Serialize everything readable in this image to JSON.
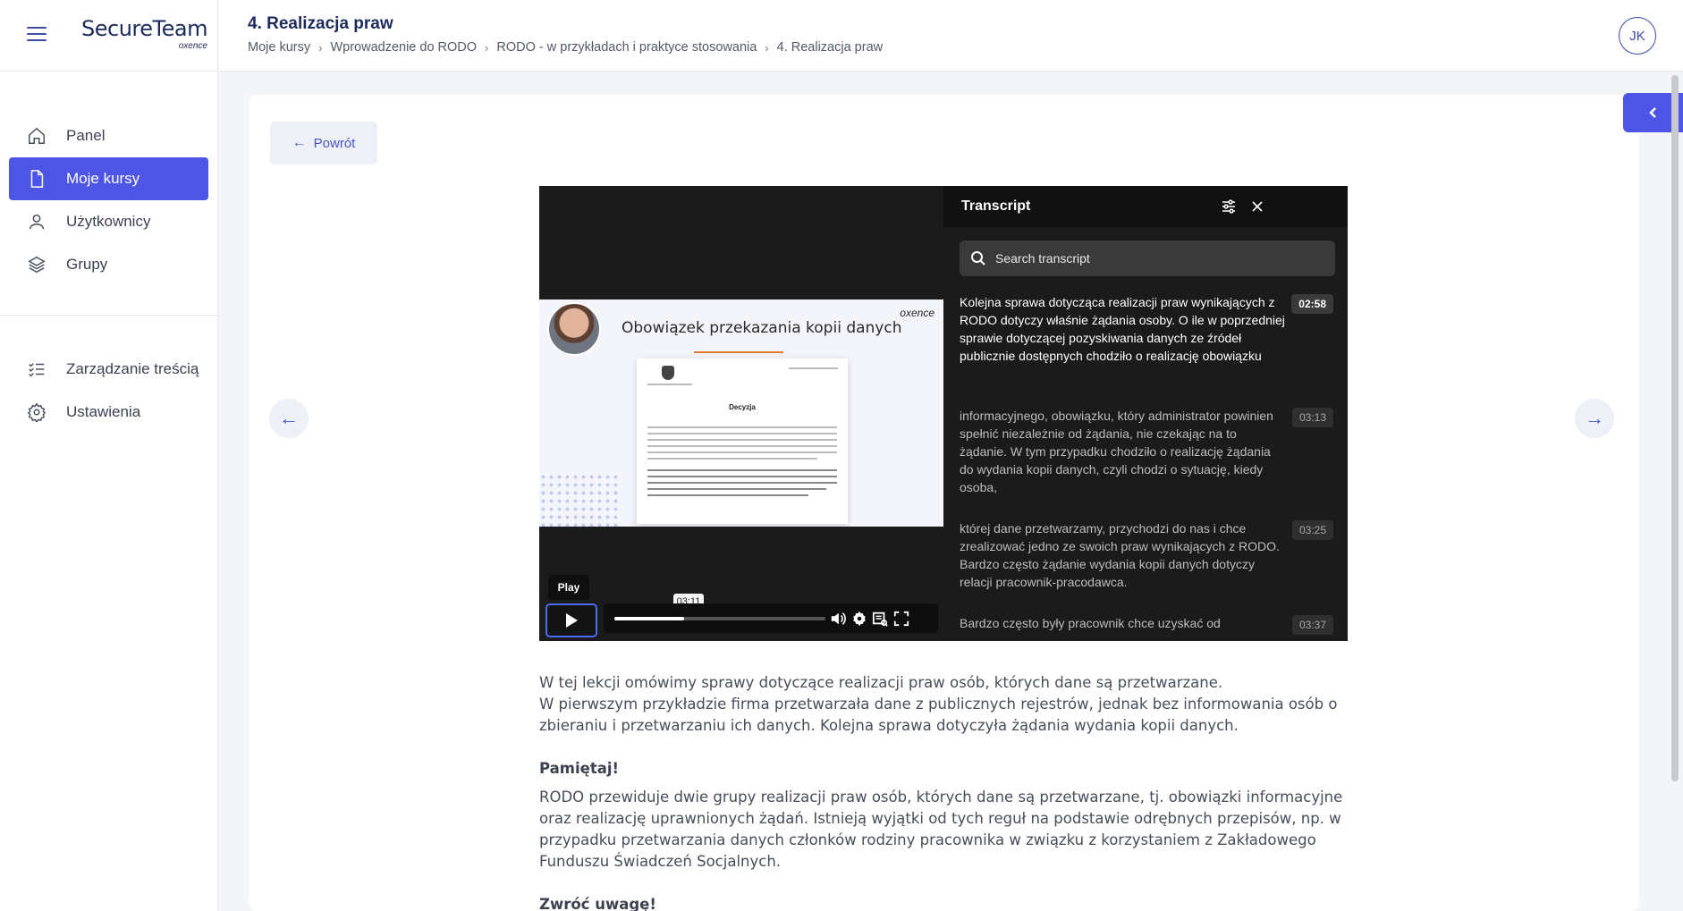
{
  "sidebar": {
    "logo_main": "SecureTeam",
    "logo_sub": "oxence",
    "items": [
      {
        "label": "Panel",
        "icon": "home-icon"
      },
      {
        "label": "Moje kursy",
        "icon": "document-icon",
        "active": true
      },
      {
        "label": "Użytkownicy",
        "icon": "user-icon"
      },
      {
        "label": "Grupy",
        "icon": "layers-icon"
      }
    ],
    "items2": [
      {
        "label": "Zarządzanie treścią",
        "icon": "checklist-icon"
      },
      {
        "label": "Ustawienia",
        "icon": "gear-icon"
      }
    ]
  },
  "header": {
    "title": "4. Realizacja praw",
    "breadcrumb": [
      "Moje kursy",
      "Wprowadzenie do RODO",
      "RODO - w przykładach i praktyce stosowania",
      "4. Realizacja praw"
    ],
    "avatar_initials": "JK"
  },
  "main": {
    "back_label": "Powrót"
  },
  "player": {
    "slide_title": "Obowiązek przekazania kopii danych",
    "slide_brand": "oxence",
    "doc_title": "Decyzja",
    "play_tooltip": "Play",
    "hover_time": "03:11",
    "progress_fraction": 0.33
  },
  "transcript": {
    "title": "Transcript",
    "search_placeholder": "Search transcript",
    "entries": [
      {
        "text": "Kolejna sprawa dotycząca realizacji praw wynikających z RODO dotyczy właśnie żądania osoby. O ile w poprzedniej sprawie dotyczącej pozyskiwania danych ze źródeł publicznie dostępnych chodziło o realizację obowiązku",
        "time": "02:58",
        "active": true
      },
      {
        "text": "informacyjnego, obowiązku, który administrator powinien spełnić niezależnie od żądania, nie czekając na to żądanie. W tym przypadku chodziło o realizację żądania do wydania kopii danych, czyli chodzi o sytuację, kiedy osoba,",
        "time": "03:13"
      },
      {
        "text": "której dane przetwarzamy, przychodzi do nas i chce zrealizować jedno ze swoich praw wynikających z RODO. Bardzo często żądanie wydania kopii danych dotyczy relacji pracownik-pracodawca.",
        "time": "03:25"
      },
      {
        "text": "Bardzo często były pracownik chce uzyskać od",
        "time": "03:37"
      }
    ]
  },
  "content": {
    "intro_line1": "W tej lekcji omówimy sprawy dotyczące realizacji praw osób, których dane są przetwarzane.",
    "intro_line2": "W pierwszym przykładzie firma przetwarzała dane z publicznych rejestrów, jednak bez informowania osób o zbieraniu i przetwarzaniu ich danych. Kolejna sprawa dotyczyła żądania wydania kopii danych.",
    "heading1": "Pamiętaj!",
    "para1": "RODO przewiduje dwie grupy realizacji praw osób, których dane są przetwarzane, tj. obowiązki informacyjne oraz realizację uprawnionych żądań. Istnieją wyjątki od tych reguł na podstawie odrębnych przepisów, np. w przypadku przetwarzania danych członków rodziny pracownika w związku z korzystaniem z Zakładowego Funduszu Świadczeń Socjalnych.",
    "heading2": "Zwróć uwagę!"
  }
}
